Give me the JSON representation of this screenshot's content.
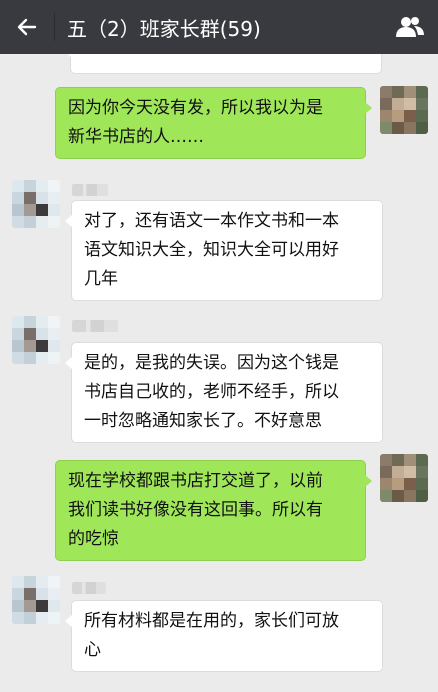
{
  "header": {
    "title": "五（2）班家长群(59)"
  },
  "messages": [
    {
      "side": "left",
      "lines": [
        "",
        ""
      ],
      "partial": true
    },
    {
      "side": "right",
      "lines": [
        "因为你今天没有发，所以我以为是",
        "新华书店的人……"
      ]
    },
    {
      "side": "left",
      "lines": [
        "对了，还有语文一本作文书和一本",
        "语文知识大全，知识大全可以用好",
        "几年"
      ]
    },
    {
      "side": "left",
      "lines": [
        "是的，是我的失误。因为这个钱是",
        "书店自己收的，老师不经手，所以",
        "一时忽略通知家长了。不好意思"
      ]
    },
    {
      "side": "right",
      "lines": [
        "现在学校都跟书店打交道了，以前",
        "我们读书好像没有这回事。所以有",
        "的吃惊"
      ]
    },
    {
      "side": "left",
      "lines": [
        "所有材料都是在用的，家长们可放",
        "心"
      ]
    }
  ],
  "colors": {
    "topbar": "#393a3f",
    "background": "#ebebeb",
    "bubble_self": "#9fe658",
    "bubble_other": "#ffffff"
  },
  "icons": {
    "back": "arrow-left-icon",
    "members": "group-members-icon"
  }
}
